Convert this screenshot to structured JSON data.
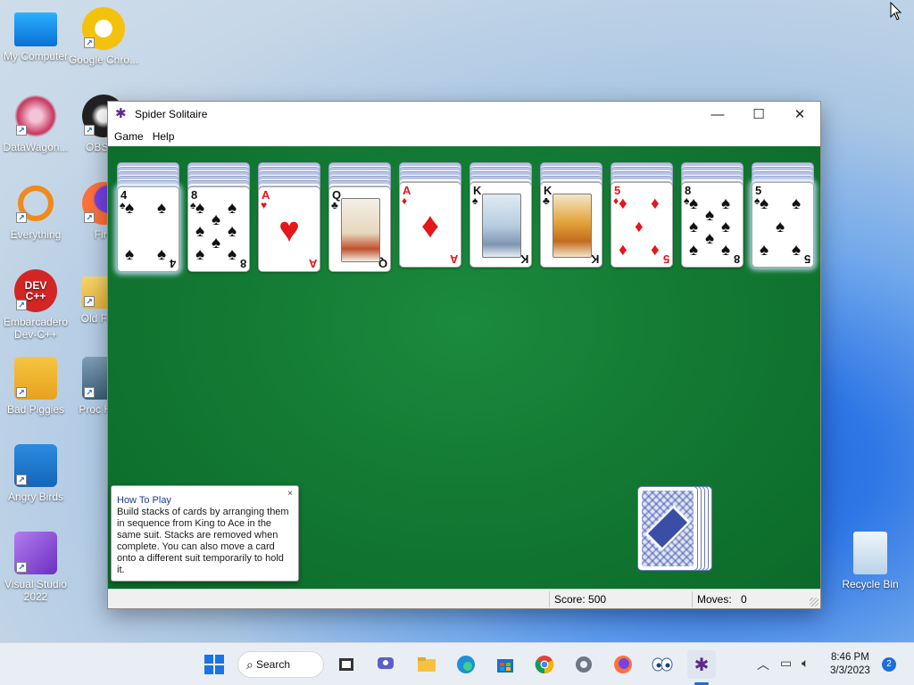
{
  "desktop": {
    "icons": [
      {
        "label": "My Computer",
        "icon": "monitor-icon"
      },
      {
        "label": "Google Chro...",
        "icon": "chrome-icon"
      },
      {
        "label": "DataWagon...",
        "icon": "datawagon-icon"
      },
      {
        "label": "OBS St",
        "icon": "obs-icon"
      },
      {
        "label": "Everything",
        "icon": "everything-search-icon"
      },
      {
        "label": "Fire",
        "icon": "firefox-icon"
      },
      {
        "label": "Embarcadero Dev-C++",
        "icon": "devcpp-icon",
        "glyph": "DEV C++"
      },
      {
        "label": "Old Fi Da",
        "icon": "folder-icon"
      },
      {
        "label": "Bad Piggies",
        "icon": "bad-piggies-icon"
      },
      {
        "label": "Proc Hack",
        "icon": "process-hacker-icon"
      },
      {
        "label": "Angry Birds",
        "icon": "angry-birds-icon"
      },
      {
        "label": "Visual Studio 2022",
        "icon": "visual-studio-icon"
      },
      {
        "label": "Recycle Bin",
        "icon": "recycle-bin-icon"
      }
    ]
  },
  "window": {
    "title": "Spider Solitaire",
    "menu": [
      "Game",
      "Help"
    ],
    "controls": {
      "minimize": "—",
      "maximize": "☐",
      "close": "✕"
    }
  },
  "game": {
    "columns": [
      {
        "hidden": 5,
        "rank": "4",
        "suit": "♠",
        "color": "black",
        "style": "pips",
        "highlight": true
      },
      {
        "hidden": 5,
        "rank": "8",
        "suit": "♠",
        "color": "black",
        "style": "pips",
        "highlight": false
      },
      {
        "hidden": 5,
        "rank": "A",
        "suit": "♥",
        "color": "red",
        "style": "ace",
        "highlight": false
      },
      {
        "hidden": 5,
        "rank": "Q",
        "suit": "♣",
        "color": "black",
        "style": "face",
        "highlight": false
      },
      {
        "hidden": 4,
        "rank": "A",
        "suit": "♦",
        "color": "red",
        "style": "ace",
        "highlight": false
      },
      {
        "hidden": 4,
        "rank": "K",
        "suit": "♠",
        "color": "black",
        "style": "face",
        "highlight": false
      },
      {
        "hidden": 4,
        "rank": "K",
        "suit": "♣",
        "color": "black",
        "style": "face",
        "highlight": false
      },
      {
        "hidden": 4,
        "rank": "5",
        "suit": "♦",
        "color": "red",
        "style": "pips",
        "highlight": false
      },
      {
        "hidden": 4,
        "rank": "8",
        "suit": "♠",
        "color": "black",
        "style": "pips",
        "highlight": false
      },
      {
        "hidden": 4,
        "rank": "5",
        "suit": "♠",
        "color": "black",
        "style": "pips",
        "highlight": true
      }
    ],
    "stock_piles": 5
  },
  "tip": {
    "title": "How To Play",
    "body": "Build stacks of cards by arranging them in sequence from King to Ace in the same suit. Stacks are removed when complete. You can also move a card onto a different suit temporarily to hold it.",
    "close": "×"
  },
  "status": {
    "score": "Score: 500",
    "moves_label": "Moves:",
    "moves_value": "0"
  },
  "taskbar": {
    "search_label": "Search",
    "apps": [
      "start-icon",
      "task-view-icon",
      "chat-icon",
      "file-explorer-icon",
      "edge-icon",
      "store-icon",
      "chrome-icon",
      "settings-icon",
      "firefox-icon",
      "eyes-icon",
      "spider-solitaire-icon"
    ],
    "time": "8:46 PM",
    "date": "3/3/2023",
    "notifications": "2"
  }
}
